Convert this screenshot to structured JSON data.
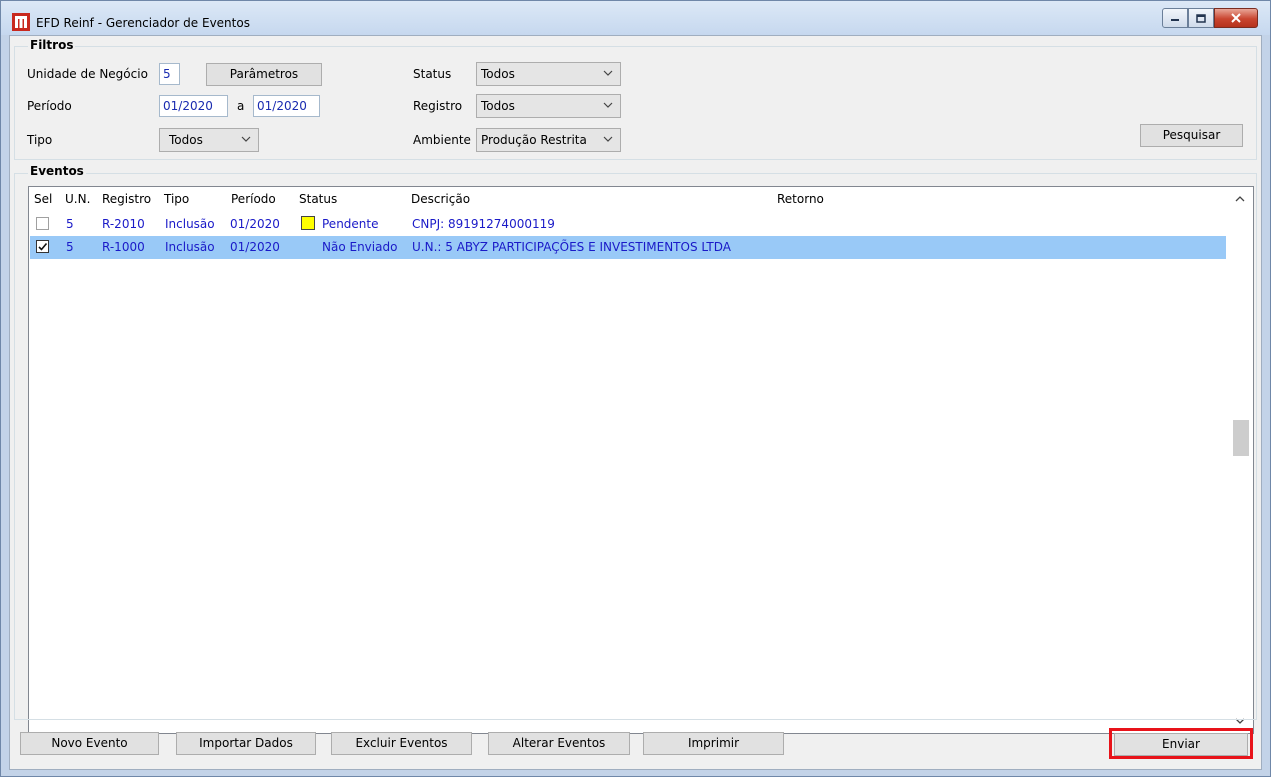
{
  "window": {
    "title": "EFD Reinf - Gerenciador de Eventos"
  },
  "filtros": {
    "legend": "Filtros",
    "unidade_label": "Unidade de Negócio",
    "unidade_value": "5",
    "parametros_button": "Parâmetros",
    "periodo_label": "Período",
    "periodo_from": "01/2020",
    "periodo_sep": "a",
    "periodo_to": "01/2020",
    "tipo_label": "Tipo",
    "tipo_value": "Todos",
    "status_label": "Status",
    "status_value": "Todos",
    "registro_label": "Registro",
    "registro_value": "Todos",
    "ambiente_label": "Ambiente",
    "ambiente_value": "Produção Restrita",
    "pesquisar_button": "Pesquisar"
  },
  "eventos": {
    "legend": "Eventos",
    "columns": [
      "Sel",
      "U.N.",
      "Registro",
      "Tipo",
      "Período",
      "Status",
      "Descrição",
      "Retorno"
    ],
    "rows": [
      {
        "selected": false,
        "un": "5",
        "registro": "R-2010",
        "tipo": "Inclusão",
        "periodo": "01/2020",
        "status": "Pendente",
        "status_color": "#ffff00",
        "descricao": "CNPJ: 89191274000119",
        "retorno": ""
      },
      {
        "selected": true,
        "un": "5",
        "registro": "R-1000",
        "tipo": "Inclusão",
        "periodo": "01/2020",
        "status": "Não Enviado",
        "status_color": "",
        "descricao": "U.N.: 5 ABYZ PARTICIPAÇÕES E INVESTIMENTOS LTDA",
        "retorno": ""
      }
    ]
  },
  "actions": {
    "novo_evento": "Novo Evento",
    "importar_dados": "Importar Dados",
    "excluir_eventos": "Excluir Eventos",
    "alterar_eventos": "Alterar Eventos",
    "imprimir": "Imprimir",
    "enviar": "Enviar"
  },
  "colors": {
    "selection": "#99c9f7",
    "value_text": "#1a1ac8",
    "highlight": "#e8131a"
  }
}
